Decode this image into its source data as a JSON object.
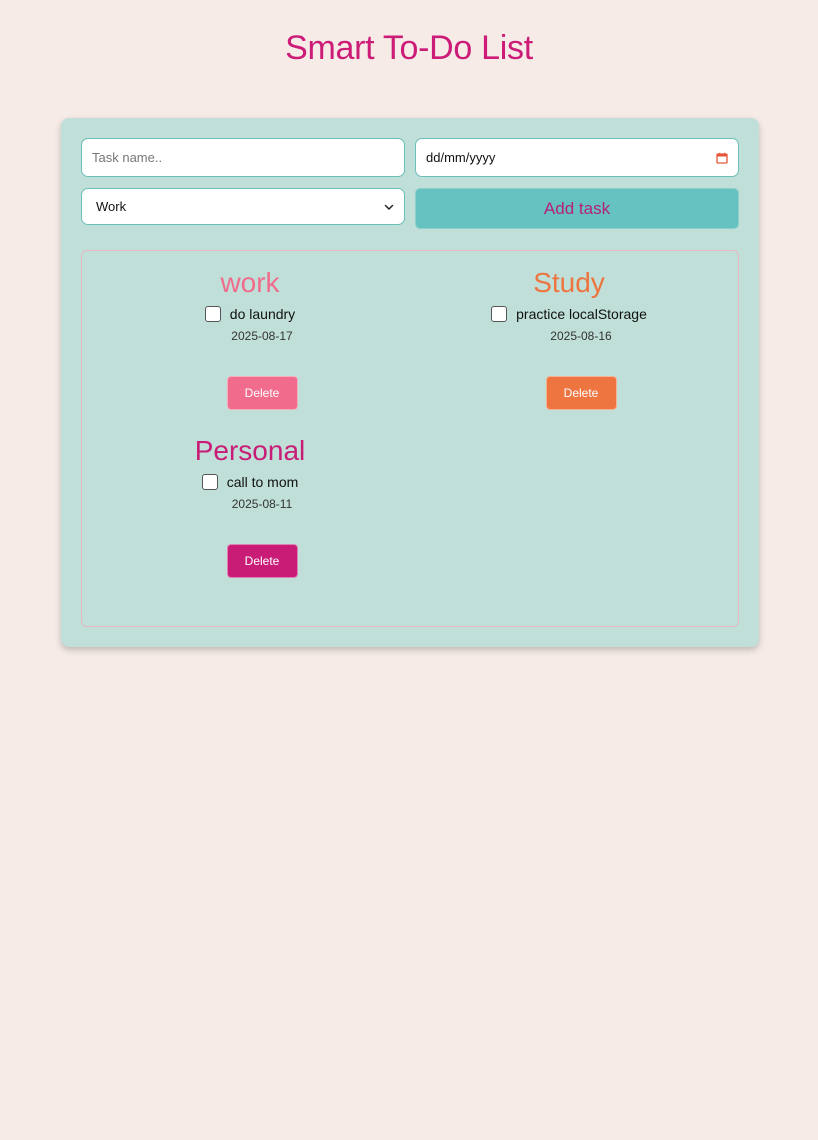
{
  "page": {
    "title": "Smart To-Do List"
  },
  "form": {
    "task_placeholder": "Task name..",
    "date_placeholder": "dd/mm/yyyy",
    "category_selected": "Work",
    "add_button_label": "Add task"
  },
  "colors": {
    "background": "#f6ebe7",
    "card": "#bfdfd8",
    "title": "#cc1c78",
    "add_button": "#66c2c0",
    "work": "#f06b8c",
    "study": "#ee7440",
    "personal": "#c91c76"
  },
  "categories": [
    {
      "title": "work",
      "color": "#f06b8c",
      "tasks": [
        {
          "name": "do laundry",
          "date": "2025-08-17",
          "done": false,
          "delete_label": "Delete"
        }
      ]
    },
    {
      "title": "Study",
      "color": "#ee7440",
      "tasks": [
        {
          "name": "practice localStorage",
          "date": "2025-08-16",
          "done": false,
          "delete_label": "Delete"
        }
      ]
    },
    {
      "title": "Personal",
      "color": "#c91c76",
      "tasks": [
        {
          "name": "call to mom",
          "date": "2025-08-11",
          "done": false,
          "delete_label": "Delete"
        }
      ]
    }
  ],
  "icons": {
    "date": "calendar-icon",
    "select": "chevron-down-icon"
  }
}
